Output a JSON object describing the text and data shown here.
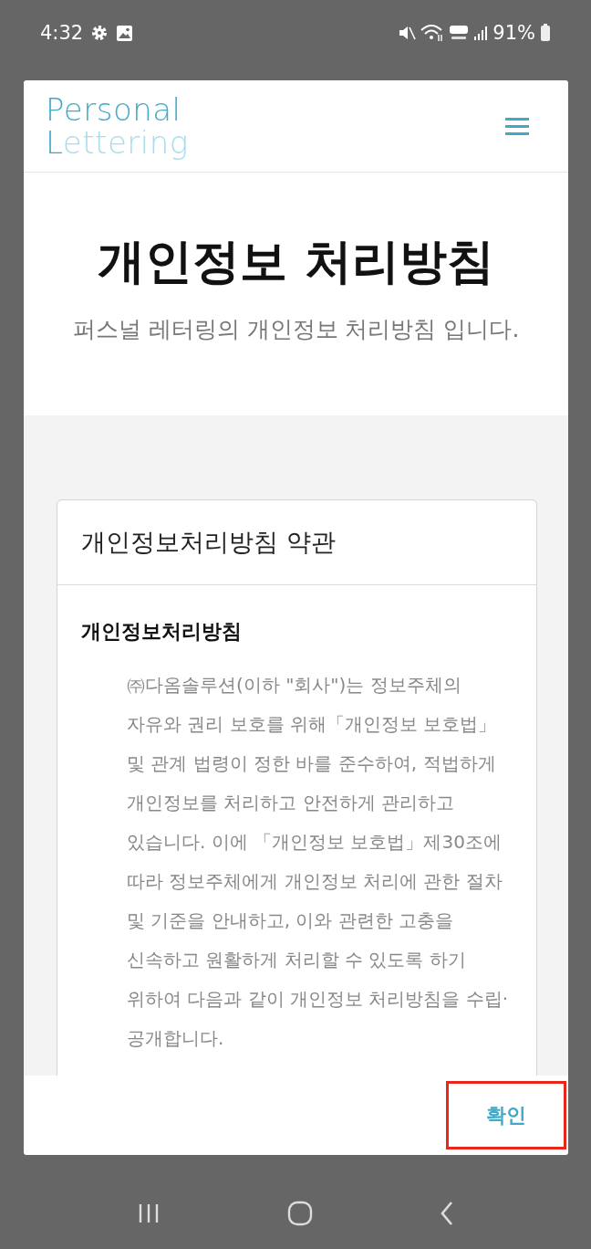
{
  "status_bar": {
    "time": "4:32",
    "battery": "91%"
  },
  "header": {
    "logo_line_1": "Personal",
    "logo_line_2_initial": "L",
    "logo_line_2_rest": "ettering"
  },
  "page": {
    "title": "개인정보 처리방침",
    "subtitle": "퍼스널 레터링의 개인정보 처리방침 입니다."
  },
  "card": {
    "title": "개인정보처리방침 약관",
    "section_title": "개인정보처리방침",
    "paragraph": "㈜다옴솔루션(이하 \"회사\")는 정보주체의 자유와 권리 보호를 위해「개인정보 보호법」 및 관계 법령이 정한 바를 준수하여, 적법하게 개인정보를 처리하고 안전하게 관리하고 있습니다. 이에 「개인정보 보호법」제30조에 따라 정보주체에게 개인정보 처리에 관한 절차 및 기준을 안내하고, 이와 관련한 고충을 신속하고 원활하게 처리할 수 있도록 하기 위하여 다음과 같이 개인정보 처리방침을 수립·공개합니다."
  },
  "footer": {
    "confirm_button": "확인"
  }
}
